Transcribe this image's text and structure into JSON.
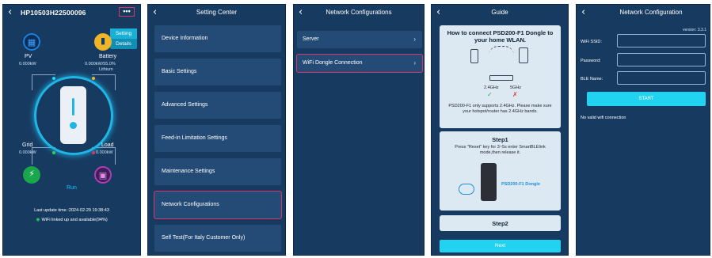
{
  "panel1": {
    "device_id": "HP10503H22500096",
    "menu_label": "•••",
    "popup": [
      "Setting",
      "Details"
    ],
    "pv": {
      "name": "PV",
      "power": "0.000kW"
    },
    "battery": {
      "name": "Battery",
      "status": "0.000kW/55.0%",
      "type": "Lithium"
    },
    "grid": {
      "name": "Grid",
      "power": "0.000kW"
    },
    "load": {
      "name": "Load",
      "power": "0.000kW"
    },
    "status": "Run",
    "last_update": "Last update time :2024-02-29 19:38:43",
    "wifi_status": "WiFi linked up and available(94%)",
    "colors": {
      "background": "#173a60",
      "accent": "#1fb6e6",
      "highlight": "#d8356b"
    }
  },
  "panel2": {
    "title": "Setting Center",
    "items": [
      "Device Information",
      "Basic Settings",
      "Advanced Settings",
      "Feed-in Limitation Settings",
      "Maintenance Settings",
      "Network Configurations",
      "Self Test(For Italy Customer Only)"
    ]
  },
  "panel3": {
    "title": "Network Configurations",
    "items": [
      "Server",
      "WiFi Dongle Connection"
    ]
  },
  "panel4": {
    "title": "Guide",
    "heading": "How to connect PSD200-F1 Dongle to your home WLAN.",
    "freq_24": "2.4GHz",
    "freq_5": "5GHz",
    "note": "PSD200-F1 only supports 2.4GHz. Please make sure your hotspot/router has 2.4GHz bands.",
    "step1_title": "Step1",
    "step1_text": "Press \"Reset\" key for 3~5s enter SmartBLElink mode,then release it.",
    "dongle_label": "PSD200-F1 Dongle",
    "step2_title": "Step2",
    "next_label": "Next"
  },
  "panel5": {
    "title": "Network Configuration",
    "version": "version: 3.3.1",
    "fields": [
      {
        "label": "WiFi SSID:",
        "value": ""
      },
      {
        "label": "Password:",
        "value": ""
      },
      {
        "label": "BLE Name:",
        "value": ""
      }
    ],
    "start_label": "START",
    "message": "No valid wifi connection"
  },
  "icons": {
    "back": "chevron-left-icon",
    "pv": "solar-panel-icon",
    "battery": "battery-icon",
    "grid": "grid-tower-icon",
    "load": "load-icon",
    "wifi": "wifi-icon",
    "router": "router-icon",
    "phone": "phone-icon"
  }
}
